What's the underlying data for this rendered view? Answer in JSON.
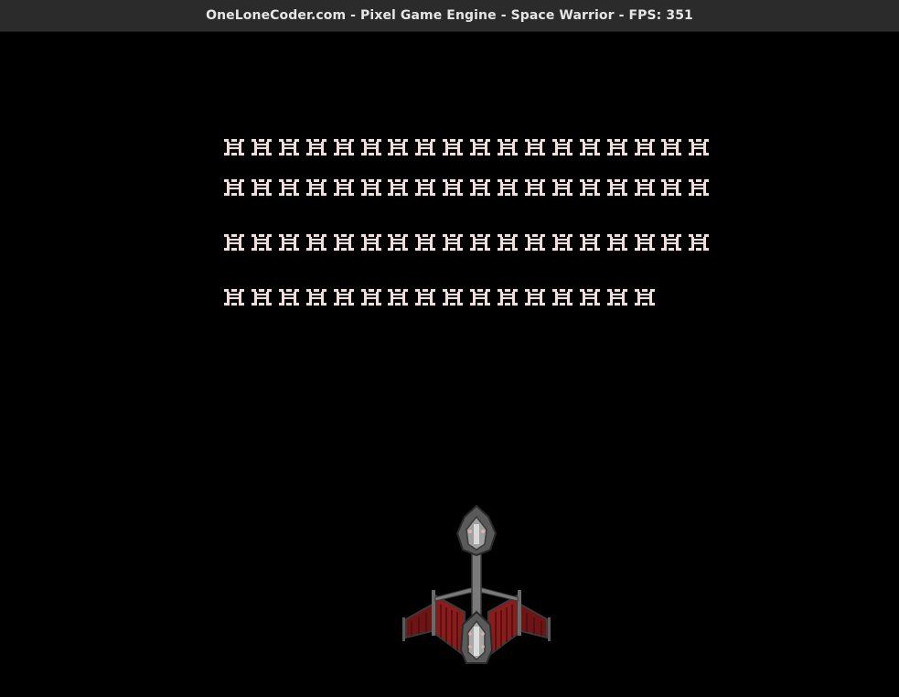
{
  "window": {
    "title": "OneLoneCoder.com - Pixel Game Engine - Space Warrior - FPS: 351"
  },
  "game": {
    "enemy_rows": [
      18,
      18,
      18,
      16
    ],
    "enemy_icon": "enemy-glyph-icon",
    "player_icon": "player-spaceship-icon",
    "colors": {
      "background": "#000000",
      "enemy": "#f2dcdc",
      "ship_gray": "#8a8a8a",
      "ship_red": "#8b1c1c"
    }
  }
}
